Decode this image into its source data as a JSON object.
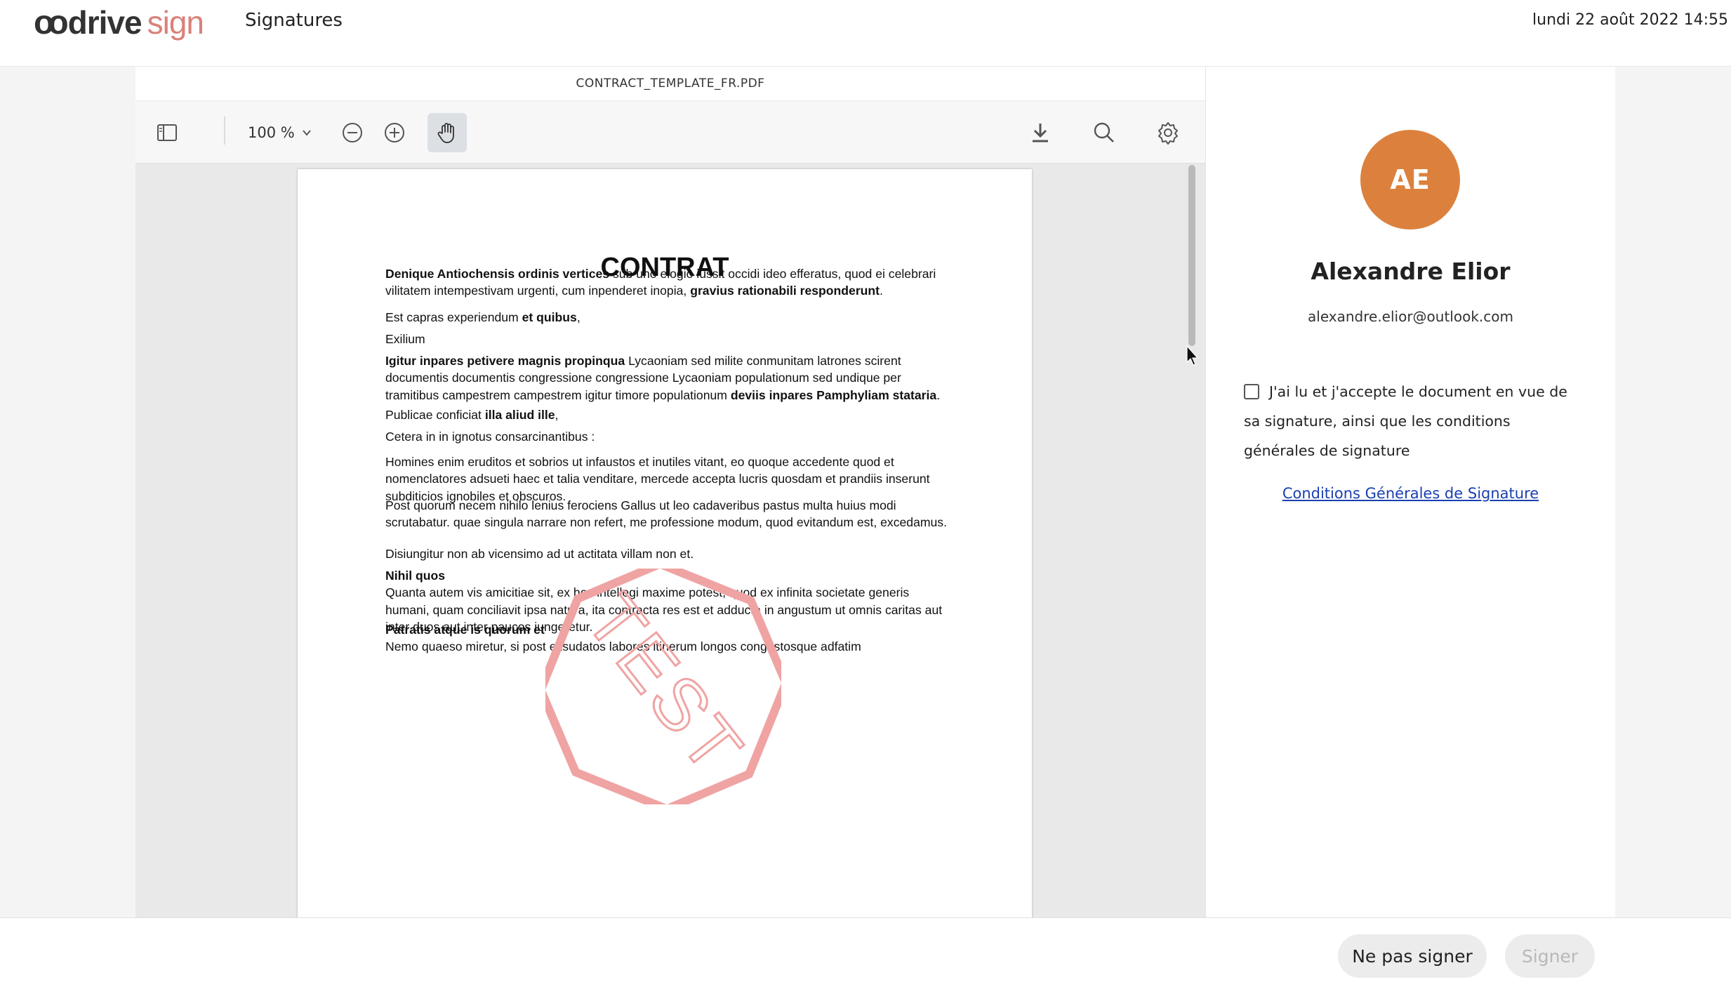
{
  "header": {
    "logo": {
      "oo": "oo",
      "drive": "drive",
      "sign": "sign"
    },
    "title": "Signatures",
    "datetime": "lundi 22 août 2022 14:55"
  },
  "viewer": {
    "filename": "CONTRACT_TEMPLATE_FR.PDF",
    "zoom": "100 %",
    "icons": [
      "sidebar-toggle-icon",
      "zoom-out-icon",
      "zoom-in-icon",
      "hand-tool-icon",
      "download-icon",
      "search-icon",
      "gear-icon"
    ]
  },
  "document": {
    "title": "CONTRAT",
    "paragraphs": [
      [
        {
          "t": "Denique Antiochensis ordinis vertices",
          "b": true
        },
        {
          "t": " sub uno elogio iussit occidi ideo efferatus, quod ei celebrari vilitatem intempestivam urgenti, cum inpenderet inopia, "
        },
        {
          "t": "gravius rationabili responderunt",
          "b": true
        },
        {
          "t": "."
        }
      ],
      [
        {
          "t": "Est capras experiendum "
        },
        {
          "t": "et quibus",
          "b": true
        },
        {
          "t": ","
        }
      ],
      [
        {
          "t": "Exilium"
        }
      ],
      [
        {
          "t": "Igitur inpares petivere magnis propinqua",
          "b": true
        },
        {
          "t": " Lycaoniam sed milite conmunitam latrones scirent documentis documentis congressione congressione Lycaoniam populationum sed undique per tramitibus campestrem campestrem igitur timore populationum "
        },
        {
          "t": "deviis inpares Pamphyliam stataria",
          "b": true
        },
        {
          "t": "."
        }
      ],
      [
        {
          "t": "Publicae conficiat "
        },
        {
          "t": "illa aliud ille",
          "b": true
        },
        {
          "t": ","
        }
      ],
      [
        {
          "t": "Cetera in in ignotus consarcinantibus :"
        }
      ],
      [
        {
          "t": "Homines enim eruditos et sobrios ut infaustos et inutiles vitant, eo quoque accedente quod et nomenclatores adsueti haec et talia venditare, mercede accepta lucris quosdam et prandiis inserunt subditicios ignobiles et obscuros."
        }
      ],
      [
        {
          "t": "Post quorum necem nihilo lenius ferociens Gallus ut leo cadaveribus pastus multa huius modi scrutabatur. quae singula narrare non refert, me professione modum, quod evitandum est, excedamus."
        }
      ],
      [
        {
          "t": "Disiungitur non ab vicensimo ad ut actitata villam non et."
        }
      ],
      [
        {
          "t": "Nihil quos",
          "b": true
        },
        {
          "t": "\nQuanta autem vis amicitiae sit, ex hoc intellegi maxime potest, quod ex infinita societate generis humani, quam conciliavit ipsa natura, ita contracta res est et adducta in angustum ut omnis caritas aut inter duos aut inter paucos iungeretur."
        }
      ],
      [
        {
          "t": "Patratis atque is quorum et",
          "b": true
        },
        {
          "t": "\nNemo quaeso miretur, si post exsudatos labores itinerum longos congestosque adfatim"
        }
      ]
    ],
    "stamp_text": "TEST"
  },
  "signer": {
    "initials": "AE",
    "name": "Alexandre Elior",
    "email": "alexandre.elior@outlook.com",
    "consent_label": "J'ai lu et j'accepte le document en vue de sa signature, ainsi que les conditions générales de signature",
    "consent_checked": false,
    "cgs_link": "Conditions Générales de Signature",
    "avatar_color": "#dc813d"
  },
  "footer": {
    "refuse_label": "Ne pas signer",
    "sign_label": "Signer"
  },
  "colors": {
    "logo_sign": "#d98179",
    "stamp": "#f0a3a3",
    "link": "#1a3fb0"
  }
}
